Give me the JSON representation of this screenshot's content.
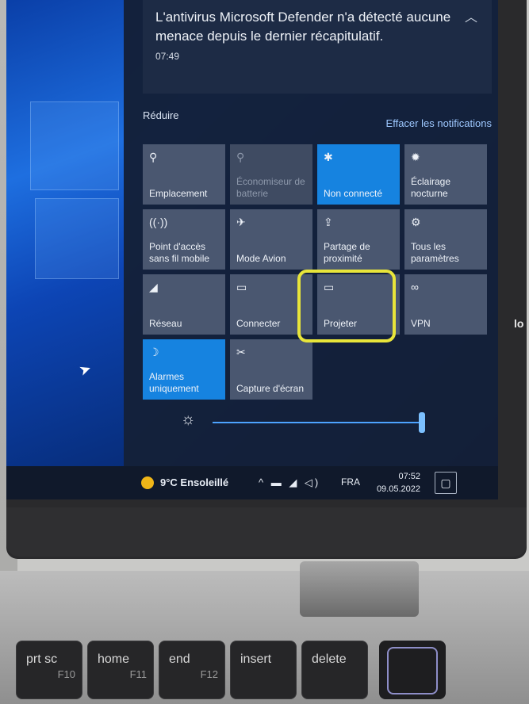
{
  "notification": {
    "text": "L'antivirus Microsoft Defender n'a détecté aucune menace depuis le dernier récapitulatif.",
    "time": "07:49"
  },
  "actions": {
    "reduce": "Réduire",
    "clear": "Effacer les notifications"
  },
  "tiles": [
    {
      "name": "tile-location",
      "label": "Emplacement",
      "icon": "⚲",
      "state": "off"
    },
    {
      "name": "tile-battery-saver",
      "label": "Économiseur de batterie",
      "icon": "⚲",
      "state": "disabled"
    },
    {
      "name": "tile-bluetooth",
      "label": "Non connecté",
      "icon": "✱",
      "state": "on"
    },
    {
      "name": "tile-night-light",
      "label": "Éclairage nocturne",
      "icon": "✹",
      "state": "off"
    },
    {
      "name": "tile-mobile-hotspot",
      "label": "Point d'accès sans fil mobile",
      "icon": "((·))",
      "state": "off"
    },
    {
      "name": "tile-airplane-mode",
      "label": "Mode Avion",
      "icon": "✈",
      "state": "off"
    },
    {
      "name": "tile-nearby-sharing",
      "label": "Partage de proximité",
      "icon": "⇪",
      "state": "off"
    },
    {
      "name": "tile-all-settings",
      "label": "Tous les paramètres",
      "icon": "⚙",
      "state": "off"
    },
    {
      "name": "tile-network",
      "label": "Réseau",
      "icon": "◢",
      "state": "off"
    },
    {
      "name": "tile-connect",
      "label": "Connecter",
      "icon": "▭",
      "state": "off"
    },
    {
      "name": "tile-project",
      "label": "Projeter",
      "icon": "▭",
      "state": "off"
    },
    {
      "name": "tile-vpn",
      "label": "VPN",
      "icon": "∞",
      "state": "off"
    },
    {
      "name": "tile-focus-assist",
      "label": "Alarmes uniquement",
      "icon": "☽",
      "state": "on"
    },
    {
      "name": "tile-screen-snip",
      "label": "Capture d'écran",
      "icon": "✂",
      "state": "off"
    }
  ],
  "brightness": {
    "level": 1.0,
    "icon": "☼"
  },
  "taskbar": {
    "weather": "9°C  Ensoleillé",
    "tray_icons": "^ ▬ ◢ ◁) ",
    "language": "FRA",
    "time": "07:52",
    "date": "09.05.2022",
    "notification_icon": "▢"
  },
  "keyboard": [
    {
      "name": "prtsc-key",
      "main": "prt sc",
      "sub": "F10"
    },
    {
      "name": "home-key",
      "main": "home",
      "sub": "F11"
    },
    {
      "name": "end-key",
      "main": "end",
      "sub": "F12"
    },
    {
      "name": "insert-key",
      "main": "insert",
      "sub": ""
    },
    {
      "name": "delete-key",
      "main": "delete",
      "sub": ""
    }
  ],
  "side_label": "lo",
  "accent": "#1683e0",
  "highlight_color": "#e8e53a"
}
